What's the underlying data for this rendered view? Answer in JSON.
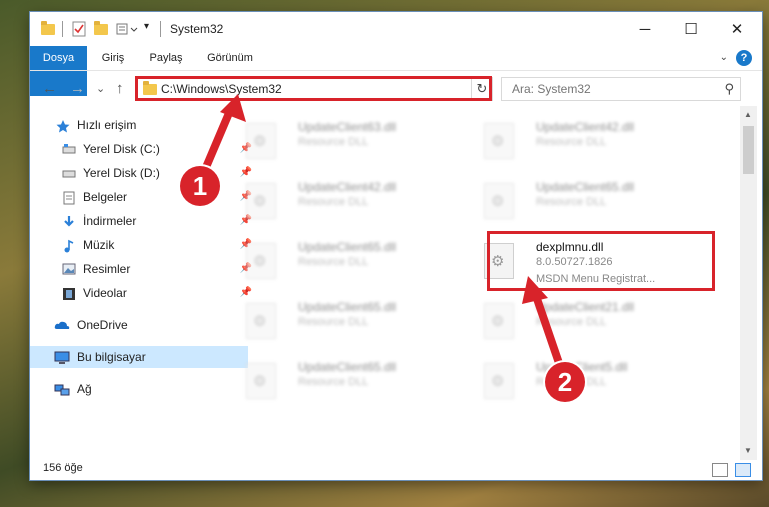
{
  "window": {
    "title": "System32",
    "controls": {
      "minimize": "─",
      "maximize": "☐",
      "close": "✕"
    }
  },
  "ribbon": {
    "tabs": [
      "Dosya",
      "Giriş",
      "Paylaş",
      "Görünüm"
    ],
    "help": "?"
  },
  "navigation": {
    "back": "←",
    "forward": "→",
    "recent": "⌄",
    "up": "↑",
    "address": "C:\\Windows\\System32",
    "refresh": "↻",
    "search_placeholder": "Ara: System32"
  },
  "sidebar": {
    "items": [
      {
        "label": "Hızlı erişim",
        "icon": "star-icon",
        "pinned": false
      },
      {
        "label": "Yerel Disk (C:)",
        "icon": "drive-icon",
        "pinned": true
      },
      {
        "label": "Yerel Disk (D:)",
        "icon": "drive-icon",
        "pinned": true
      },
      {
        "label": "Belgeler",
        "icon": "documents-icon",
        "pinned": true
      },
      {
        "label": "İndirmeler",
        "icon": "download-icon",
        "pinned": true
      },
      {
        "label": "Müzik",
        "icon": "music-icon",
        "pinned": true
      },
      {
        "label": "Resimler",
        "icon": "pictures-icon",
        "pinned": true
      },
      {
        "label": "Videolar",
        "icon": "video-icon",
        "pinned": true
      },
      {
        "label": "OneDrive",
        "icon": "cloud-icon",
        "pinned": false
      },
      {
        "label": "Bu bilgisayar",
        "icon": "computer-icon",
        "pinned": false,
        "selected": true
      },
      {
        "label": "Ağ",
        "icon": "network-icon",
        "pinned": false
      }
    ]
  },
  "files": {
    "left_column": [
      {
        "name": "UpdateClient63.dll",
        "type": "Resource DLL"
      },
      {
        "name": "UpdateClient42.dll",
        "type": "Resource DLL"
      },
      {
        "name": "UpdateClient65.dll",
        "type": "Resource DLL"
      },
      {
        "name": "UpdateClient65.dll",
        "type": "Resource DLL"
      },
      {
        "name": "UpdateClient65.dll",
        "type": "Resource DLL"
      }
    ],
    "right_column": [
      {
        "name": "UpdateClient42.dll",
        "type": "Resource DLL"
      },
      {
        "name": "UpdateClient65.dll",
        "type": "Resource DLL"
      },
      {
        "name": "dexplmnu.dll",
        "version": "8.0.50727.1826",
        "description": "MSDN Menu Registrat..."
      },
      {
        "name": "UpdateClient21.dll",
        "type": "Resource DLL"
      },
      {
        "name": "UpdateClient5.dll",
        "type": "Resource DLL"
      }
    ]
  },
  "status": {
    "item_count": "156 öğe"
  },
  "annotations": {
    "step1": "1",
    "step2": "2",
    "color": "#d8232a"
  }
}
